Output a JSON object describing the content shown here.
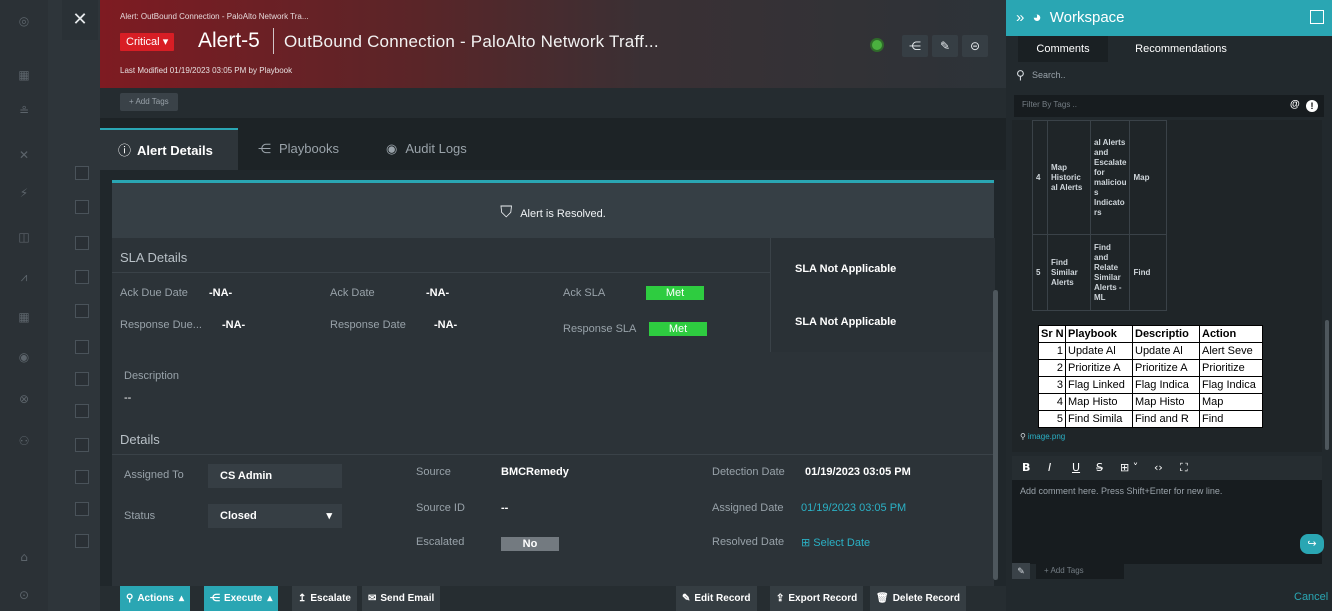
{
  "header": {
    "breadcrumb": "Alert: OutBound Connection - PaloAlto Network Tra...",
    "severity": "Critical",
    "severity_caret": "▾",
    "alert_id": "Alert-5",
    "title": "OutBound Connection - PaloAlto Network Traff...",
    "last_modified": "Last Modified 01/19/2023 03:05 PM by Playbook",
    "add_tags": "+ Add Tags",
    "accent": "#d81e25"
  },
  "tabs": [
    {
      "icon": "ⓘ",
      "label": "Alert Details"
    },
    {
      "icon": "⋲",
      "label": "Playbooks"
    },
    {
      "icon": "◉",
      "label": "Audit Logs"
    }
  ],
  "resolved": {
    "text": "Alert is Resolved."
  },
  "sla": {
    "title": "SLA Details",
    "ack_due_label": "Ack Due Date",
    "ack_due_value": "-NA-",
    "ack_date_label": "Ack Date",
    "ack_date_value": "-NA-",
    "ack_sla_label": "Ack SLA",
    "ack_sla_value": "Met",
    "resp_due_label": "Response Due...",
    "resp_due_value": "-NA-",
    "resp_date_label": "Response Date",
    "resp_date_value": "-NA-",
    "resp_sla_label": "Response SLA",
    "resp_sla_value": "Met",
    "ack_applicable": "SLA Not Applicable",
    "resp_applicable": "SLA Not Applicable",
    "met_color": "#2ecc40"
  },
  "description": {
    "label": "Description",
    "value": "--"
  },
  "details": {
    "title": "Details",
    "assigned_to_label": "Assigned To",
    "assigned_to_value": "CS Admin",
    "status_label": "Status",
    "status_value": "Closed",
    "status_caret": "▾",
    "source_label": "Source",
    "source_value": "BMCRemedy",
    "source_id_label": "Source ID",
    "source_id_value": "--",
    "escalated_label": "Escalated",
    "escalated_value": "No",
    "detection_label": "Detection Date",
    "detection_value": "01/19/2023 03:05 PM",
    "assigned_date_label": "Assigned Date",
    "assigned_date_value": "01/19/2023 03:05 PM",
    "resolved_date_label": "Resolved Date",
    "resolved_date_value": "Select Date"
  },
  "footer": {
    "actions": "Actions",
    "execute": "Execute",
    "escalate": "Escalate",
    "send_email": "Send Email",
    "edit_record": "Edit Record",
    "export_record": "Export Record",
    "delete_record": "Delete Record"
  },
  "workspace": {
    "title": "Workspace",
    "tab_comments": "Comments",
    "tab_recommendations": "Recommendations",
    "search_placeholder": "Search..",
    "filter_placeholder": "Filter By Tags ..",
    "at_sign": "@",
    "comment_table": [
      {
        "no": "4",
        "playbook": "Map Historic al Alerts",
        "desc": "al Alerts and Escalate for maliciou s Indicato rs",
        "action": "Map"
      },
      {
        "no": "5",
        "playbook": "Find Similar Alerts",
        "desc": "Find and Relate Similar Alerts - ML",
        "action": "Find"
      }
    ],
    "image_table": {
      "headers": [
        "Sr N",
        "Playbook",
        "Descriptio",
        "Action"
      ],
      "rows": [
        [
          "1",
          "Update Al",
          "Update Al",
          "Alert Seve"
        ],
        [
          "2",
          "Prioritize A",
          "Prioritize A",
          "Prioritize"
        ],
        [
          "3",
          "Flag Linked",
          "Flag Indica",
          "Flag Indica"
        ],
        [
          "4",
          "Map Histo",
          "Map Histo",
          "Map"
        ],
        [
          "5",
          "Find Simila",
          "Find and R",
          "Find"
        ]
      ]
    },
    "image_link": "image.png",
    "editor_placeholder": "Add comment here. Press Shift+Enter for new line.",
    "add_tags": "+ Add Tags",
    "cancel": "Cancel"
  }
}
